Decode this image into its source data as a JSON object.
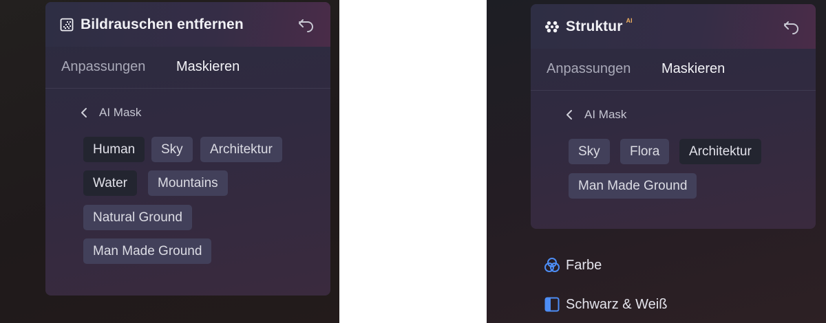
{
  "left_panel": {
    "title": "Bildrauschen entfernen",
    "icon": "noise-grid-icon",
    "undo_icon": "undo-icon",
    "tabs": [
      {
        "label": "Anpassungen",
        "active": false
      },
      {
        "label": "Maskieren",
        "active": true
      }
    ],
    "back_label": "AI Mask",
    "chips": [
      {
        "label": "Human",
        "selected": true
      },
      {
        "label": "Sky",
        "selected": false
      },
      {
        "label": "Architektur",
        "selected": false
      },
      {
        "label": "Water",
        "selected": true
      },
      {
        "label": "Mountains",
        "selected": false
      },
      {
        "label": "Natural Ground",
        "selected": false
      },
      {
        "label": "Man Made Ground",
        "selected": false
      }
    ]
  },
  "right_panel": {
    "title": "Struktur",
    "badge": "AI",
    "icon": "structure-dots-icon",
    "undo_icon": "undo-icon",
    "tabs": [
      {
        "label": "Anpassungen",
        "active": false
      },
      {
        "label": "Maskieren",
        "active": true
      }
    ],
    "back_label": "AI Mask",
    "chips": [
      {
        "label": "Sky",
        "selected": false
      },
      {
        "label": "Flora",
        "selected": false
      },
      {
        "label": "Architektur",
        "selected": true
      },
      {
        "label": "Man Made Ground",
        "selected": false
      }
    ]
  },
  "menu_items": [
    {
      "label": "Farbe",
      "icon": "color-circles-icon"
    },
    {
      "label": "Schwarz & Weiß",
      "icon": "black-white-icon"
    }
  ],
  "colors": {
    "accent_blue": "#4d8df5",
    "ai_badge": "#f0b060",
    "chip": "#42405a",
    "chip_selected": "#232530"
  }
}
